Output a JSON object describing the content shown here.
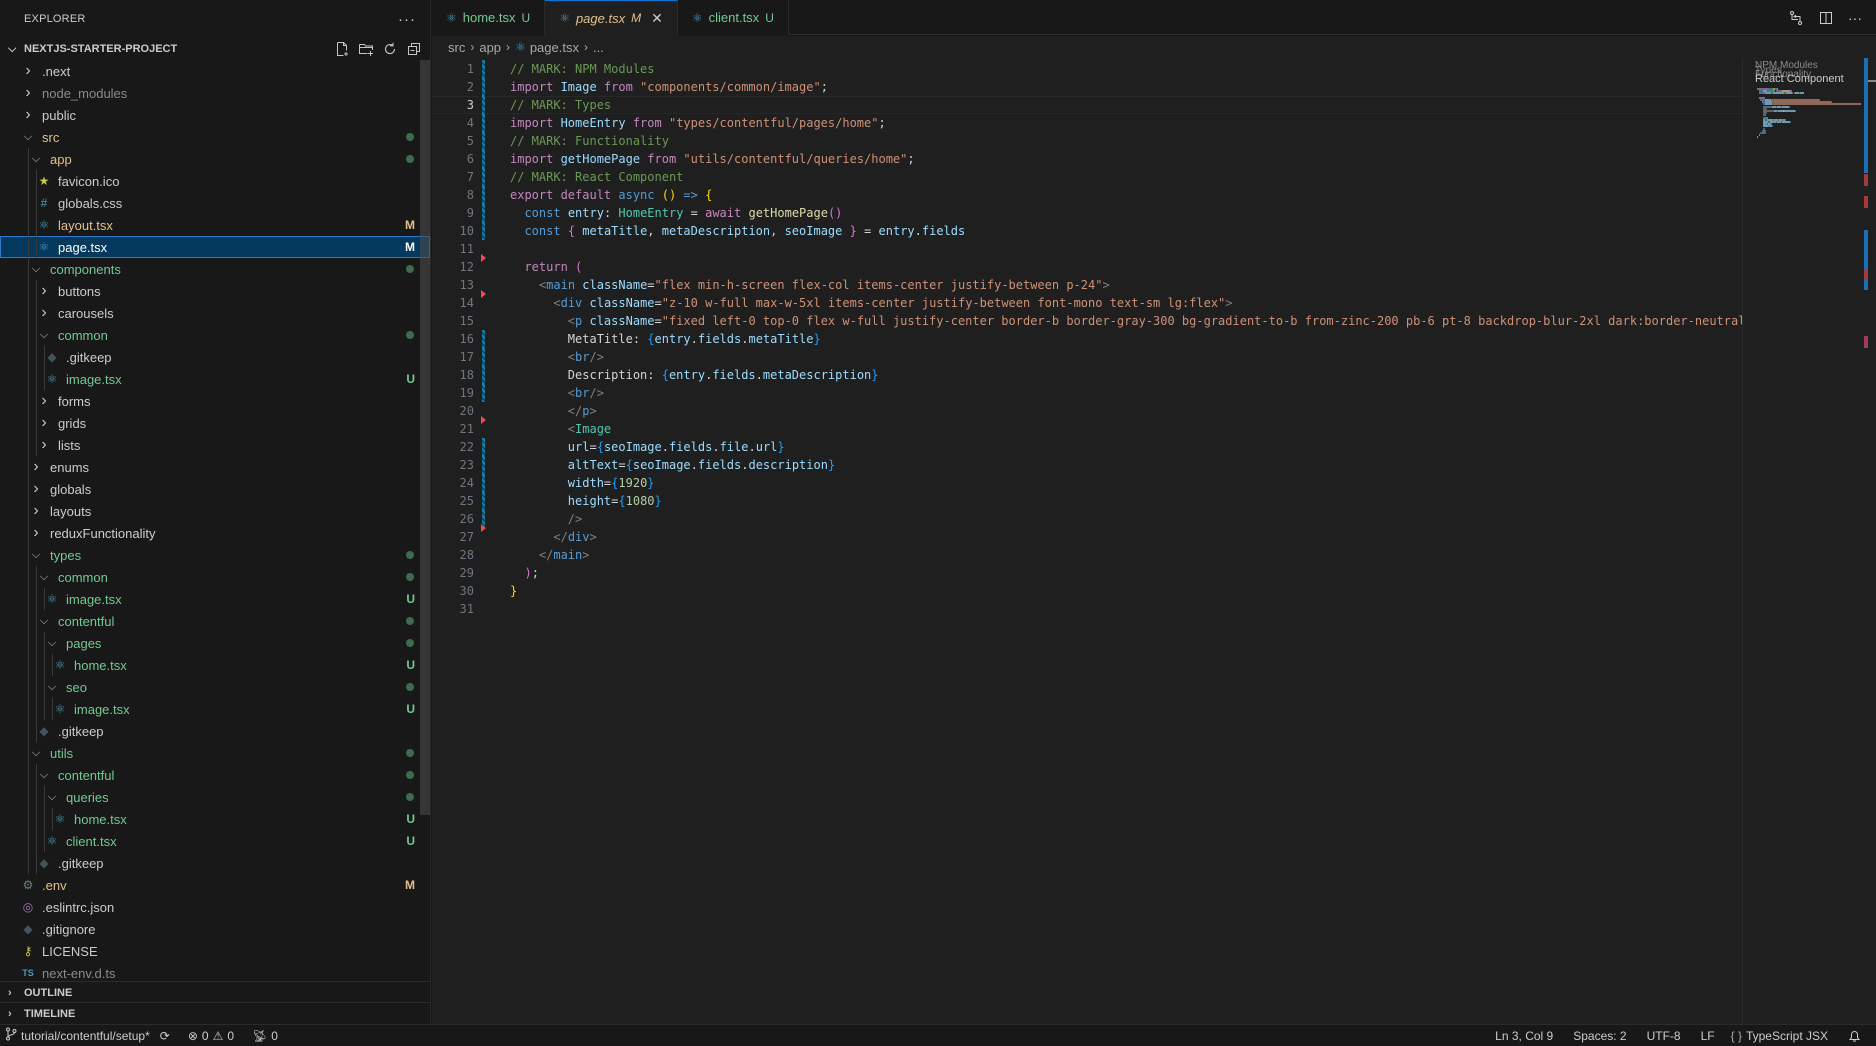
{
  "sidebar": {
    "title": "EXPLORER",
    "more_label": "···",
    "project": "NEXTJS-STARTER-PROJECT",
    "actions": [
      {
        "name": "new-file",
        "icon": "new-file-icon"
      },
      {
        "name": "new-folder",
        "icon": "new-folder-icon"
      },
      {
        "name": "refresh",
        "icon": "refresh-icon"
      },
      {
        "name": "collapse-all",
        "icon": "collapse-all-icon"
      }
    ],
    "tree": [
      {
        "label": ".next",
        "depth": 0,
        "type": "folder",
        "open": false,
        "color": "default"
      },
      {
        "label": "node_modules",
        "depth": 0,
        "type": "folder",
        "open": false,
        "color": "dim"
      },
      {
        "label": "public",
        "depth": 0,
        "type": "folder",
        "open": false,
        "color": "default"
      },
      {
        "label": "src",
        "depth": 0,
        "type": "folder",
        "open": true,
        "color": "modified",
        "dot": true
      },
      {
        "label": "app",
        "depth": 1,
        "type": "folder",
        "open": true,
        "color": "modified",
        "dot": true
      },
      {
        "label": "favicon.ico",
        "depth": 2,
        "type": "file",
        "icon": "star",
        "color": "default"
      },
      {
        "label": "globals.css",
        "depth": 2,
        "type": "file",
        "icon": "hash",
        "color": "default"
      },
      {
        "label": "layout.tsx",
        "depth": 2,
        "type": "file",
        "icon": "react",
        "color": "modified",
        "badge": "M"
      },
      {
        "label": "page.tsx",
        "depth": 2,
        "type": "file",
        "icon": "react",
        "color": "sel",
        "badge": "M",
        "selected": true
      },
      {
        "label": "components",
        "depth": 1,
        "type": "folder",
        "open": true,
        "color": "untracked",
        "dot": true
      },
      {
        "label": "buttons",
        "depth": 2,
        "type": "folder",
        "open": false,
        "color": "default"
      },
      {
        "label": "carousels",
        "depth": 2,
        "type": "folder",
        "open": false,
        "color": "default"
      },
      {
        "label": "common",
        "depth": 2,
        "type": "folder",
        "open": true,
        "color": "untracked",
        "dot": true
      },
      {
        "label": ".gitkeep",
        "depth": 3,
        "type": "file",
        "icon": "git",
        "color": "default"
      },
      {
        "label": "image.tsx",
        "depth": 3,
        "type": "file",
        "icon": "react",
        "color": "untracked",
        "badge": "U"
      },
      {
        "label": "forms",
        "depth": 2,
        "type": "folder",
        "open": false,
        "color": "default"
      },
      {
        "label": "grids",
        "depth": 2,
        "type": "folder",
        "open": false,
        "color": "default"
      },
      {
        "label": "lists",
        "depth": 2,
        "type": "folder",
        "open": false,
        "color": "default"
      },
      {
        "label": "enums",
        "depth": 1,
        "type": "folder",
        "open": false,
        "color": "default"
      },
      {
        "label": "globals",
        "depth": 1,
        "type": "folder",
        "open": false,
        "color": "default"
      },
      {
        "label": "layouts",
        "depth": 1,
        "type": "folder",
        "open": false,
        "color": "default"
      },
      {
        "label": "reduxFunctionality",
        "depth": 1,
        "type": "folder",
        "open": false,
        "color": "default"
      },
      {
        "label": "types",
        "depth": 1,
        "type": "folder",
        "open": true,
        "color": "untracked",
        "dot": true
      },
      {
        "label": "common",
        "depth": 2,
        "type": "folder",
        "open": true,
        "color": "untracked",
        "dot": true
      },
      {
        "label": "image.tsx",
        "depth": 3,
        "type": "file",
        "icon": "react",
        "color": "untracked",
        "badge": "U"
      },
      {
        "label": "contentful",
        "depth": 2,
        "type": "folder",
        "open": true,
        "color": "untracked",
        "dot": true
      },
      {
        "label": "pages",
        "depth": 3,
        "type": "folder",
        "open": true,
        "color": "untracked",
        "dot": true
      },
      {
        "label": "home.tsx",
        "depth": 4,
        "type": "file",
        "icon": "react",
        "color": "untracked",
        "badge": "U"
      },
      {
        "label": "seo",
        "depth": 3,
        "type": "folder",
        "open": true,
        "color": "untracked",
        "dot": true
      },
      {
        "label": "image.tsx",
        "depth": 4,
        "type": "file",
        "icon": "react",
        "color": "untracked",
        "badge": "U"
      },
      {
        "label": ".gitkeep",
        "depth": 2,
        "type": "file",
        "icon": "git",
        "color": "default"
      },
      {
        "label": "utils",
        "depth": 1,
        "type": "folder",
        "open": true,
        "color": "untracked",
        "dot": true
      },
      {
        "label": "contentful",
        "depth": 2,
        "type": "folder",
        "open": true,
        "color": "untracked",
        "dot": true
      },
      {
        "label": "queries",
        "depth": 3,
        "type": "folder",
        "open": true,
        "color": "untracked",
        "dot": true
      },
      {
        "label": "home.tsx",
        "depth": 4,
        "type": "file",
        "icon": "react",
        "color": "untracked",
        "badge": "U"
      },
      {
        "label": "client.tsx",
        "depth": 3,
        "type": "file",
        "icon": "react",
        "color": "untracked",
        "badge": "U"
      },
      {
        "label": ".gitkeep",
        "depth": 2,
        "type": "file",
        "icon": "git",
        "color": "default"
      },
      {
        "label": ".env",
        "depth": 0,
        "type": "file",
        "icon": "gear",
        "color": "modified",
        "badge": "M"
      },
      {
        "label": ".eslintrc.json",
        "depth": 0,
        "type": "file",
        "icon": "eslint",
        "color": "default"
      },
      {
        "label": ".gitignore",
        "depth": 0,
        "type": "file",
        "icon": "git",
        "color": "default"
      },
      {
        "label": "LICENSE",
        "depth": 0,
        "type": "file",
        "icon": "license",
        "color": "default"
      },
      {
        "label": "next-env.d.ts",
        "depth": 0,
        "type": "file",
        "icon": "ts",
        "color": "dim"
      }
    ],
    "sections": [
      "OUTLINE",
      "TIMELINE"
    ]
  },
  "tabs": [
    {
      "name": "home.tsx",
      "status": "U",
      "active": false
    },
    {
      "name": "page.tsx",
      "status": "M",
      "active": true
    },
    {
      "name": "client.tsx",
      "status": "U",
      "active": false
    }
  ],
  "breadcrumb": [
    "src",
    "app",
    "page.tsx",
    "..."
  ],
  "editor": {
    "current_line": 3,
    "lines": [
      [
        [
          "t-com",
          "// MARK: NPM Modules"
        ]
      ],
      [
        [
          "t-kw",
          "import "
        ],
        [
          "t-var",
          "Image"
        ],
        [
          "t-kw",
          " from "
        ],
        [
          "t-st",
          "\"components/common/image\""
        ],
        [
          "t-plain",
          ";"
        ]
      ],
      [
        [
          "t-com",
          "// MARK: Types"
        ]
      ],
      [
        [
          "t-kw",
          "import "
        ],
        [
          "t-var",
          "HomeEntry"
        ],
        [
          "t-kw",
          " from "
        ],
        [
          "t-st",
          "\"types/contentful/pages/home\""
        ],
        [
          "t-plain",
          ";"
        ]
      ],
      [
        [
          "t-com",
          "// MARK: Functionality"
        ]
      ],
      [
        [
          "t-kw",
          "import "
        ],
        [
          "t-var",
          "getHomePage"
        ],
        [
          "t-kw",
          " from "
        ],
        [
          "t-st",
          "\"utils/contentful/queries/home\""
        ],
        [
          "t-plain",
          ";"
        ]
      ],
      [
        [
          "t-com",
          "// MARK: React Component"
        ]
      ],
      [
        [
          "t-kw",
          "export default "
        ],
        [
          "t-bl",
          "async "
        ],
        [
          "t-br1",
          "() "
        ],
        [
          "t-bl",
          "=> "
        ],
        [
          "t-br1",
          "{"
        ]
      ],
      [
        [
          "t-plain",
          "  "
        ],
        [
          "t-bl",
          "const "
        ],
        [
          "t-var",
          "entry"
        ],
        [
          "t-plain",
          ": "
        ],
        [
          "t-type",
          "HomeEntry"
        ],
        [
          "t-plain",
          " = "
        ],
        [
          "t-kw",
          "await "
        ],
        [
          "t-fn",
          "getHomePage"
        ],
        [
          "t-br2",
          "()"
        ]
      ],
      [
        [
          "t-plain",
          "  "
        ],
        [
          "t-bl",
          "const "
        ],
        [
          "t-br2",
          "{ "
        ],
        [
          "t-var",
          "metaTitle"
        ],
        [
          "t-plain",
          ", "
        ],
        [
          "t-var",
          "metaDescription"
        ],
        [
          "t-plain",
          ", "
        ],
        [
          "t-var",
          "seoImage"
        ],
        [
          "t-br2",
          " }"
        ],
        [
          "t-plain",
          " = "
        ],
        [
          "t-var",
          "entry"
        ],
        [
          "t-plain",
          "."
        ],
        [
          "t-var",
          "fields"
        ]
      ],
      [],
      [
        [
          "t-plain",
          "  "
        ],
        [
          "t-kw",
          "return "
        ],
        [
          "t-br2",
          "("
        ]
      ],
      [
        [
          "t-plain",
          "    "
        ],
        [
          "t-ang",
          "<"
        ],
        [
          "t-tag",
          "main "
        ],
        [
          "t-attr",
          "className"
        ],
        [
          "t-plain",
          "="
        ],
        [
          "t-st",
          "\"flex min-h-screen flex-col items-center justify-between p-24\""
        ],
        [
          "t-ang",
          ">"
        ]
      ],
      [
        [
          "t-plain",
          "      "
        ],
        [
          "t-ang",
          "<"
        ],
        [
          "t-tag",
          "div "
        ],
        [
          "t-attr",
          "className"
        ],
        [
          "t-plain",
          "="
        ],
        [
          "t-st",
          "\"z-10 w-full max-w-5xl items-center justify-between font-mono text-sm lg:flex\""
        ],
        [
          "t-ang",
          ">"
        ]
      ],
      [
        [
          "t-plain",
          "        "
        ],
        [
          "t-ang",
          "<"
        ],
        [
          "t-tag",
          "p "
        ],
        [
          "t-attr",
          "className"
        ],
        [
          "t-plain",
          "="
        ],
        [
          "t-st",
          "\"fixed left-0 top-0 flex w-full justify-center border-b border-gray-300 bg-gradient-to-b from-zinc-200 pb-6 pt-8 backdrop-blur-2xl dark:border-neutral-"
        ]
      ],
      [
        [
          "t-plain",
          "        MetaTitle: "
        ],
        [
          "t-br3",
          "{"
        ],
        [
          "t-var",
          "entry"
        ],
        [
          "t-plain",
          "."
        ],
        [
          "t-var",
          "fields"
        ],
        [
          "t-plain",
          "."
        ],
        [
          "t-var",
          "metaTitle"
        ],
        [
          "t-br3",
          "}"
        ]
      ],
      [
        [
          "t-plain",
          "        "
        ],
        [
          "t-ang",
          "<"
        ],
        [
          "t-tag",
          "br"
        ],
        [
          "t-ang",
          "/>"
        ]
      ],
      [
        [
          "t-plain",
          "        Description: "
        ],
        [
          "t-br3",
          "{"
        ],
        [
          "t-var",
          "entry"
        ],
        [
          "t-plain",
          "."
        ],
        [
          "t-var",
          "fields"
        ],
        [
          "t-plain",
          "."
        ],
        [
          "t-var",
          "metaDescription"
        ],
        [
          "t-br3",
          "}"
        ]
      ],
      [
        [
          "t-plain",
          "        "
        ],
        [
          "t-ang",
          "<"
        ],
        [
          "t-tag",
          "br"
        ],
        [
          "t-ang",
          "/>"
        ]
      ],
      [
        [
          "t-plain",
          "        "
        ],
        [
          "t-ang",
          "</"
        ],
        [
          "t-tag",
          "p"
        ],
        [
          "t-ang",
          ">"
        ]
      ],
      [
        [
          "t-plain",
          "        "
        ],
        [
          "t-ang",
          "<"
        ],
        [
          "t-type",
          "Image"
        ]
      ],
      [
        [
          "t-plain",
          "        "
        ],
        [
          "t-attr",
          "url"
        ],
        [
          "t-plain",
          "="
        ],
        [
          "t-br3",
          "{"
        ],
        [
          "t-var",
          "seoImage"
        ],
        [
          "t-plain",
          "."
        ],
        [
          "t-var",
          "fields"
        ],
        [
          "t-plain",
          "."
        ],
        [
          "t-var",
          "file"
        ],
        [
          "t-plain",
          "."
        ],
        [
          "t-var",
          "url"
        ],
        [
          "t-br3",
          "}"
        ]
      ],
      [
        [
          "t-plain",
          "        "
        ],
        [
          "t-attr",
          "altText"
        ],
        [
          "t-plain",
          "="
        ],
        [
          "t-br3",
          "{"
        ],
        [
          "t-var",
          "seoImage"
        ],
        [
          "t-plain",
          "."
        ],
        [
          "t-var",
          "fields"
        ],
        [
          "t-plain",
          "."
        ],
        [
          "t-var",
          "description"
        ],
        [
          "t-br3",
          "}"
        ]
      ],
      [
        [
          "t-plain",
          "        "
        ],
        [
          "t-attr",
          "width"
        ],
        [
          "t-plain",
          "="
        ],
        [
          "t-br3",
          "{"
        ],
        [
          "t-num",
          "1920"
        ],
        [
          "t-br3",
          "}"
        ]
      ],
      [
        [
          "t-plain",
          "        "
        ],
        [
          "t-attr",
          "height"
        ],
        [
          "t-plain",
          "="
        ],
        [
          "t-br3",
          "{"
        ],
        [
          "t-num",
          "1080"
        ],
        [
          "t-br3",
          "}"
        ]
      ],
      [
        [
          "t-plain",
          "        "
        ],
        [
          "t-ang",
          "/>"
        ]
      ],
      [
        [
          "t-plain",
          "      "
        ],
        [
          "t-ang",
          "</"
        ],
        [
          "t-tag",
          "div"
        ],
        [
          "t-ang",
          ">"
        ]
      ],
      [
        [
          "t-plain",
          "    "
        ],
        [
          "t-ang",
          "</"
        ],
        [
          "t-tag",
          "main"
        ],
        [
          "t-ang",
          ">"
        ]
      ],
      [
        [
          "t-plain",
          "  "
        ],
        [
          "t-br2",
          ")"
        ],
        [
          "t-plain",
          ";"
        ]
      ],
      [
        [
          "t-br1",
          "}"
        ]
      ],
      []
    ],
    "modified_lines": [
      1,
      2,
      3,
      4,
      5,
      6,
      7,
      8,
      9,
      10,
      16,
      17,
      18,
      19,
      22,
      23,
      24,
      25,
      26
    ],
    "deleted_markers": [
      12,
      14,
      21,
      27
    ],
    "minimap_labels": [
      "NPM Modules",
      "Types",
      "Functionality",
      "React Component"
    ]
  },
  "tab_actions": [
    {
      "name": "open-changes",
      "icon": "git-compare-icon"
    },
    {
      "name": "split-editor",
      "icon": "split-editor-icon"
    },
    {
      "name": "more-actions",
      "icon": "more-icon"
    }
  ],
  "statusbar": {
    "branch": "tutorial/contentful/setup*",
    "errors": "0",
    "warnings": "0",
    "ports": "0",
    "position": "Ln 3, Col 9",
    "spaces": "Spaces: 2",
    "encoding": "UTF-8",
    "eol": "LF",
    "language": "TypeScript JSX"
  }
}
